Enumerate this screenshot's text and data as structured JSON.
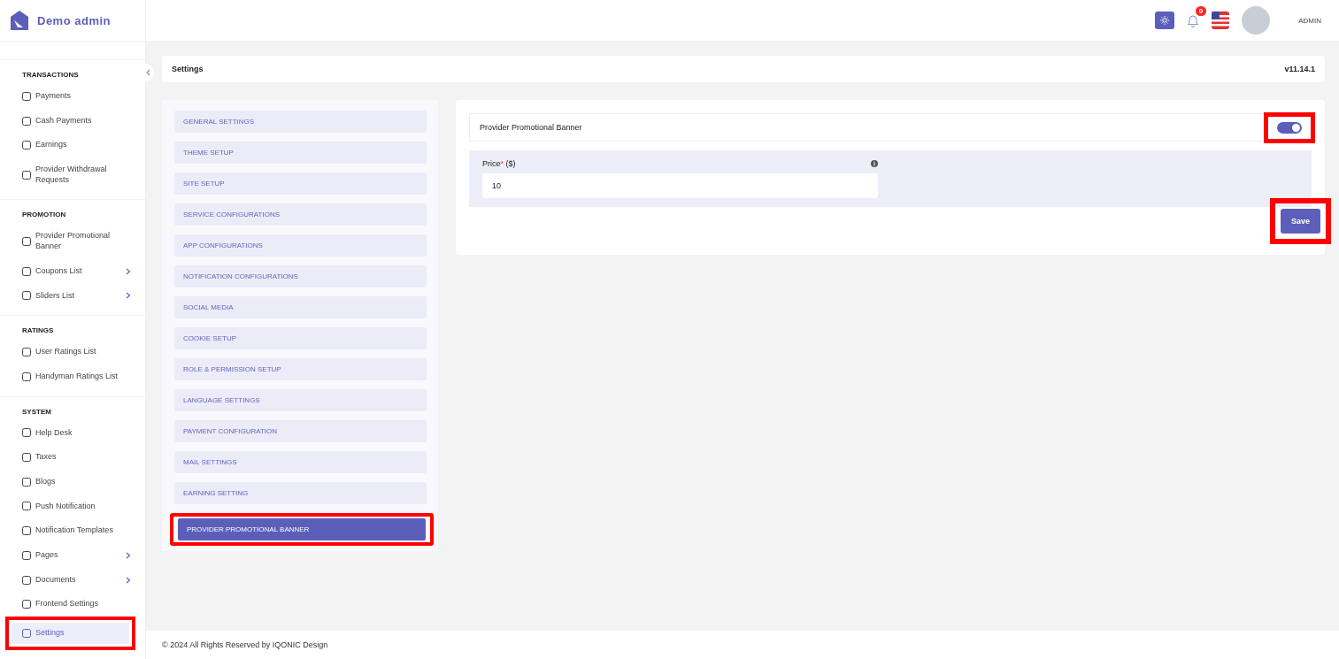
{
  "brand": {
    "name": "Demo admin"
  },
  "header": {
    "notifications": "0",
    "user": "ADMIN"
  },
  "sidebar": {
    "sections": [
      {
        "title": "TRANSACTIONS",
        "items": [
          {
            "label": "Payments",
            "selected": false,
            "has_submenu": false,
            "highlighted": false
          },
          {
            "label": "Cash Payments",
            "selected": false,
            "has_submenu": false,
            "highlighted": false
          },
          {
            "label": "Earnings",
            "selected": false,
            "has_submenu": false,
            "highlighted": false
          },
          {
            "label": "Provider Withdrawal Requests",
            "selected": false,
            "has_submenu": false,
            "highlighted": false
          }
        ]
      },
      {
        "title": "PROMOTION",
        "items": [
          {
            "label": "Provider Promotional Banner",
            "selected": false,
            "has_submenu": false,
            "highlighted": false
          },
          {
            "label": "Coupons List",
            "selected": false,
            "has_submenu": true,
            "highlighted": false
          },
          {
            "label": "Sliders List",
            "selected": false,
            "has_submenu": true,
            "highlighted": false
          }
        ]
      },
      {
        "title": "RATINGS",
        "items": [
          {
            "label": "User Ratings List",
            "selected": false,
            "has_submenu": false,
            "highlighted": false
          },
          {
            "label": "Handyman Ratings List",
            "selected": false,
            "has_submenu": false,
            "highlighted": false
          }
        ]
      },
      {
        "title": "SYSTEM",
        "items": [
          {
            "label": "Help Desk",
            "selected": false,
            "has_submenu": false,
            "highlighted": false
          },
          {
            "label": "Taxes",
            "selected": false,
            "has_submenu": false,
            "highlighted": false
          },
          {
            "label": "Blogs",
            "selected": false,
            "has_submenu": false,
            "highlighted": false
          },
          {
            "label": "Push Notification",
            "selected": false,
            "has_submenu": false,
            "highlighted": false
          },
          {
            "label": "Notification Templates",
            "selected": false,
            "has_submenu": false,
            "highlighted": false
          },
          {
            "label": "Pages",
            "selected": false,
            "has_submenu": true,
            "highlighted": false
          },
          {
            "label": "Documents",
            "selected": false,
            "has_submenu": true,
            "highlighted": false
          },
          {
            "label": "Frontend Settings",
            "selected": false,
            "has_submenu": false,
            "highlighted": false
          },
          {
            "label": "Settings",
            "selected": true,
            "has_submenu": false,
            "highlighted": true
          }
        ]
      }
    ]
  },
  "breadcrumb": {
    "title": "Settings",
    "version": "v11.14.1"
  },
  "settings_menu": [
    {
      "label": "GENERAL SETTINGS",
      "selected": false,
      "highlighted": false
    },
    {
      "label": "THEME SETUP",
      "selected": false,
      "highlighted": false
    },
    {
      "label": "SITE SETUP",
      "selected": false,
      "highlighted": false
    },
    {
      "label": "SERVICE CONFIGURATIONS",
      "selected": false,
      "highlighted": false
    },
    {
      "label": "APP CONFIGURATIONS",
      "selected": false,
      "highlighted": false
    },
    {
      "label": "NOTIFICATION CONFIGURATIONS",
      "selected": false,
      "highlighted": false
    },
    {
      "label": "SOCIAL MEDIA",
      "selected": false,
      "highlighted": false
    },
    {
      "label": "COOKIE SETUP",
      "selected": false,
      "highlighted": false
    },
    {
      "label": "ROLE & PERMISSION SETUP",
      "selected": false,
      "highlighted": false
    },
    {
      "label": "LANGUAGE SETTINGS",
      "selected": false,
      "highlighted": false
    },
    {
      "label": "PAYMENT CONFIGURATION",
      "selected": false,
      "highlighted": false
    },
    {
      "label": "MAIL SETTINGS",
      "selected": false,
      "highlighted": false
    },
    {
      "label": "EARNING SETTING",
      "selected": false,
      "highlighted": false
    },
    {
      "label": "PROVIDER PROMOTIONAL BANNER",
      "selected": true,
      "highlighted": true
    }
  ],
  "panel": {
    "title": "Provider Promotional Banner",
    "toggle": {
      "on": true,
      "highlighted": true
    },
    "price_label": "Price",
    "required_mark": "*",
    "currency": "($)",
    "price_value": "10",
    "save": {
      "label": "Save",
      "highlighted": true
    }
  },
  "footer": "© 2024 All Rights Reserved by IQONIC Design"
}
